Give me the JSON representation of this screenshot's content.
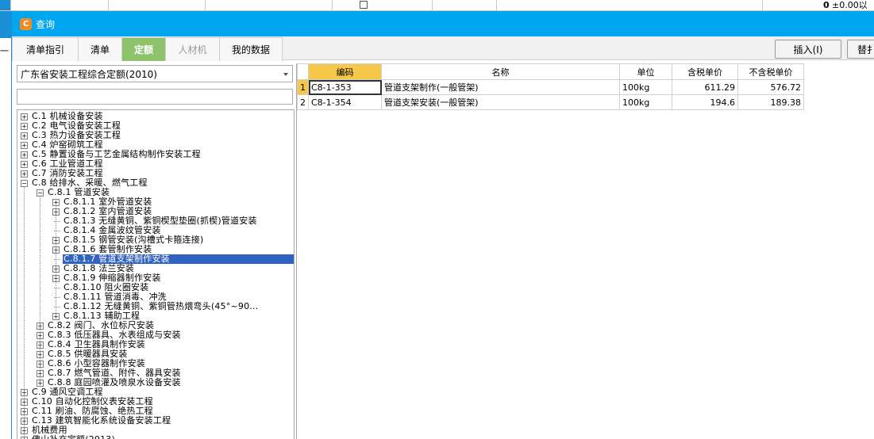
{
  "background": {
    "zero_value": "0",
    "elevation_text": "±0.00以",
    "left_text": "一"
  },
  "dialog": {
    "title": "查询",
    "icon": "app-logo-icon",
    "tabs": [
      {
        "label": "清单指引",
        "state": "normal"
      },
      {
        "label": "清单",
        "state": "normal"
      },
      {
        "label": "定额",
        "state": "active"
      },
      {
        "label": "人材机",
        "state": "disabled"
      },
      {
        "label": "我的数据",
        "state": "normal"
      }
    ],
    "buttons": {
      "insert": "插入(I)",
      "replace": "替扌"
    }
  },
  "left": {
    "library_select": "广东省安装工程综合定额(2010)",
    "search_value": "",
    "tree": [
      {
        "label": "C.1 机械设备安装",
        "level": 0,
        "expander": "+"
      },
      {
        "label": "C.2 电气设备安装工程",
        "level": 0,
        "expander": "+"
      },
      {
        "label": "C.3 热力设备安装工程",
        "level": 0,
        "expander": "+"
      },
      {
        "label": "C.4 炉窑砌筑工程",
        "level": 0,
        "expander": "+"
      },
      {
        "label": "C.5 静置设备与工艺金属结构制作安装工程",
        "level": 0,
        "expander": "+"
      },
      {
        "label": "C.6 工业管道工程",
        "level": 0,
        "expander": "+"
      },
      {
        "label": "C.7 消防安装工程",
        "level": 0,
        "expander": "+"
      },
      {
        "label": "C.8 给排水、采暖、燃气工程",
        "level": 0,
        "expander": "-"
      },
      {
        "label": "C.8.1 管道安装",
        "level": 1,
        "expander": "-"
      },
      {
        "label": "C.8.1.1 室外管道安装",
        "level": 2,
        "expander": "+"
      },
      {
        "label": "C.8.1.2 室内管道安装",
        "level": 2,
        "expander": "+"
      },
      {
        "label": "C.8.1.3 无缝黄铜、紫铜楔型垫圈(抓楔)管道安装",
        "level": 2,
        "expander": ""
      },
      {
        "label": "C.8.1.4 金属波纹管安装",
        "level": 2,
        "expander": ""
      },
      {
        "label": "C.8.1.5 钢管安装(沟槽式卡箍连接)",
        "level": 2,
        "expander": "+"
      },
      {
        "label": "C.8.1.6 套管制作安装",
        "level": 2,
        "expander": "+"
      },
      {
        "label": "C.8.1.7 管道支架制作安装",
        "level": 2,
        "expander": "",
        "selected": true
      },
      {
        "label": "C.8.1.8 法兰安装",
        "level": 2,
        "expander": "+"
      },
      {
        "label": "C.8.1.9 伸缩器制作安装",
        "level": 2,
        "expander": "+"
      },
      {
        "label": "C.8.1.10 阻火圈安装",
        "level": 2,
        "expander": ""
      },
      {
        "label": "C.8.1.11 管道消毒、冲洗",
        "level": 2,
        "expander": ""
      },
      {
        "label": "C.8.1.12 无缝黄铜、紫铜管热煨弯头(45°~90…",
        "level": 2,
        "expander": ""
      },
      {
        "label": "C.8.1.13 辅助工程",
        "level": 2,
        "expander": "+"
      },
      {
        "label": "C.8.2 阀门、水位标尺安装",
        "level": 1,
        "expander": "+"
      },
      {
        "label": "C.8.3 低压器具、水表组成与安装",
        "level": 1,
        "expander": "+"
      },
      {
        "label": "C.8.4 卫生器具制作安装",
        "level": 1,
        "expander": "+"
      },
      {
        "label": "C.8.5 供暖器具安装",
        "level": 1,
        "expander": "+"
      },
      {
        "label": "C.8.6 小型容器制作安装",
        "level": 1,
        "expander": "+"
      },
      {
        "label": "C.8.7 燃气管道、附件、器具安装",
        "level": 1,
        "expander": "+"
      },
      {
        "label": "C.8.8 庭园喷灌及喷泉水设备安装",
        "level": 1,
        "expander": "+"
      },
      {
        "label": "C.9 通风空调工程",
        "level": 0,
        "expander": "+"
      },
      {
        "label": "C.10 自动化控制仪表安装工程",
        "level": 0,
        "expander": "+"
      },
      {
        "label": "C.11 刷油、防腐蚀、绝热工程",
        "level": 0,
        "expander": "+"
      },
      {
        "label": "C.13 建筑智能化系统设备安装工程",
        "level": 0,
        "expander": "+"
      },
      {
        "label": "机械费用",
        "level": 0,
        "expander": "+"
      },
      {
        "label": "佛山补充定额(2013)",
        "level": 0,
        "expander": "+"
      }
    ]
  },
  "table": {
    "columns": [
      "编码",
      "名称",
      "单位",
      "含税单价",
      "不含税单价"
    ],
    "rows": [
      {
        "rn": "1",
        "code": "C8-1-353",
        "name": "管道支架制作(一般管架)",
        "unit": "100kg",
        "price_tax": "611.29",
        "price_notax": "576.72"
      },
      {
        "rn": "2",
        "code": "C8-1-354",
        "name": "管道支架安装(一般管架)",
        "unit": "100kg",
        "price_tax": "194.6",
        "price_notax": "189.38"
      }
    ]
  },
  "colors": {
    "titlebar": "#00a6f0",
    "active_tab": "#8fc36b",
    "selection": "#2f63c2",
    "code_header": "#f6c84a"
  }
}
